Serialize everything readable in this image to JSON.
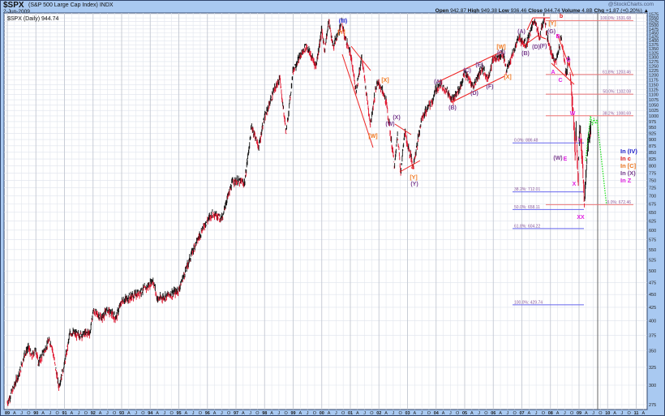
{
  "header": {
    "symbol": "$SPX",
    "name": "(S&P 500 Large Cap Index) INDX",
    "date": "2-Jun-2009",
    "brand": "@StockCharts.com",
    "open_label": "Open",
    "open": "942.87",
    "high_label": "High",
    "high": "949.38",
    "low_label": "Low",
    "low": "936.46",
    "close_label": "Close",
    "close": "944.74",
    "volume_label": "Volume",
    "volume": "4.8B",
    "chg_label": "Chg",
    "chg": "+1.87 (+0.20%)",
    "chg_arrow": "▲"
  },
  "legend": {
    "label": "$SPX (Daily) 944.74"
  },
  "colors": {
    "price": "#111111",
    "price_down": "#e0102a",
    "trend": "#ee2222",
    "fib_red": "#ee7777",
    "fib_blue": "#6666ee",
    "fib_text": "#8a5a9a",
    "projection": "#22dd22",
    "wave_purple": "#7a3f8f",
    "wave_orange": "#f07820",
    "wave_blue": "#2222cc",
    "wave_magenta": "#e020e0",
    "wave_red": "#e02020"
  },
  "chart_data": {
    "type": "line",
    "title": "$SPX (Daily) 944.74",
    "y_scale": "log",
    "ylim": [
      265,
      1590
    ],
    "xlim": [
      1989.0,
      2011.4
    ],
    "grid": true,
    "y_ticks": [
      275,
      300,
      325,
      350,
      375,
      400,
      425,
      450,
      475,
      500,
      525,
      550,
      575,
      600,
      625,
      650,
      675,
      700,
      725,
      750,
      775,
      800,
      825,
      850,
      875,
      900,
      925,
      950,
      975,
      1000,
      1025,
      1050,
      1075,
      1100,
      1125,
      1150,
      1175,
      1200,
      1225,
      1250,
      1275,
      1300,
      1325,
      1350,
      1375,
      1400,
      1425,
      1450,
      1475,
      1500,
      1525,
      1550,
      1575
    ],
    "x_tick_labels": [
      "89",
      "A",
      "J",
      "O",
      "90",
      "A",
      "J",
      "O",
      "91",
      "A",
      "J",
      "O",
      "92",
      "A",
      "J",
      "O",
      "93",
      "A",
      "J",
      "O",
      "94",
      "A",
      "J",
      "O",
      "95",
      "A",
      "J",
      "O",
      "96",
      "A",
      "J",
      "O",
      "97",
      "A",
      "J",
      "O",
      "98",
      "A",
      "J",
      "O",
      "99",
      "A",
      "J",
      "O",
      "00",
      "A",
      "J",
      "O",
      "01",
      "A",
      "J",
      "O",
      "02",
      "A",
      "J",
      "O",
      "03",
      "A",
      "J",
      "O",
      "04",
      "A",
      "J",
      "O",
      "05",
      "A",
      "J",
      "O",
      "06",
      "A",
      "J",
      "O",
      "07",
      "A",
      "J",
      "O",
      "08",
      "A",
      "J",
      "O",
      "09",
      "A",
      "J",
      "O",
      "10",
      "A",
      "J",
      "O",
      "11",
      "A"
    ],
    "series": [
      {
        "points": [
          [
            1989.0,
            277
          ],
          [
            1989.2,
            295
          ],
          [
            1989.45,
            320
          ],
          [
            1989.6,
            345
          ],
          [
            1989.75,
            355
          ],
          [
            1989.85,
            340
          ],
          [
            1990.0,
            353
          ],
          [
            1990.08,
            330
          ],
          [
            1990.45,
            365
          ],
          [
            1990.55,
            360
          ],
          [
            1990.8,
            298
          ],
          [
            1991.0,
            330
          ],
          [
            1991.2,
            380
          ],
          [
            1991.5,
            375
          ],
          [
            1991.9,
            380
          ],
          [
            1992.0,
            418
          ],
          [
            1992.3,
            405
          ],
          [
            1992.5,
            420
          ],
          [
            1992.8,
            405
          ],
          [
            1993.0,
            436
          ],
          [
            1993.5,
            450
          ],
          [
            1993.9,
            465
          ],
          [
            1994.1,
            480
          ],
          [
            1994.25,
            440
          ],
          [
            1994.9,
            455
          ],
          [
            1995.0,
            460
          ],
          [
            1995.5,
            550
          ],
          [
            1995.9,
            615
          ],
          [
            1996.2,
            650
          ],
          [
            1996.55,
            630
          ],
          [
            1996.6,
            665
          ],
          [
            1996.9,
            750
          ],
          [
            1997.3,
            740
          ],
          [
            1997.55,
            955
          ],
          [
            1997.8,
            870
          ],
          [
            1997.95,
            970
          ],
          [
            1998.3,
            1110
          ],
          [
            1998.53,
            1185
          ],
          [
            1998.76,
            925
          ],
          [
            1999.0,
            1230
          ],
          [
            1999.45,
            1370
          ],
          [
            1999.8,
            1250
          ],
          [
            2000.0,
            1470
          ],
          [
            2000.1,
            1345
          ],
          [
            2000.25,
            1525
          ],
          [
            2000.4,
            1360
          ],
          [
            2000.7,
            1520
          ],
          [
            2000.78,
            1440
          ],
          [
            2001.0,
            1320
          ],
          [
            2001.2,
            1120
          ],
          [
            2001.4,
            1300
          ],
          [
            2001.7,
            965
          ],
          [
            2001.9,
            1140
          ],
          [
            2002.0,
            1160
          ],
          [
            2002.25,
            1070
          ],
          [
            2002.55,
            800
          ],
          [
            2002.65,
            920
          ],
          [
            2002.77,
            776
          ],
          [
            2002.9,
            940
          ],
          [
            2003.0,
            880
          ],
          [
            2003.2,
            800
          ],
          [
            2003.5,
            990
          ],
          [
            2003.9,
            1080
          ],
          [
            2004.0,
            1130
          ],
          [
            2004.2,
            1150
          ],
          [
            2004.6,
            1075
          ],
          [
            2004.85,
            1140
          ],
          [
            2005.0,
            1210
          ],
          [
            2005.3,
            1140
          ],
          [
            2005.6,
            1240
          ],
          [
            2005.8,
            1180
          ],
          [
            2006.0,
            1290
          ],
          [
            2006.35,
            1320
          ],
          [
            2006.45,
            1225
          ],
          [
            2006.9,
            1420
          ],
          [
            2007.15,
            1375
          ],
          [
            2007.45,
            1540
          ],
          [
            2007.62,
            1410
          ],
          [
            2007.78,
            1565
          ],
          [
            2007.9,
            1410
          ],
          [
            2008.05,
            1310
          ],
          [
            2008.2,
            1275
          ],
          [
            2008.38,
            1425
          ],
          [
            2008.55,
            1200
          ],
          [
            2008.65,
            1300
          ],
          [
            2008.75,
            1100
          ],
          [
            2008.81,
            1000
          ],
          [
            2008.87,
            840
          ],
          [
            2008.9,
            950
          ],
          [
            2008.97,
            750
          ],
          [
            2009.0,
            900
          ],
          [
            2009.05,
            940
          ],
          [
            2009.15,
            750
          ],
          [
            2009.19,
            676
          ],
          [
            2009.3,
            870
          ],
          [
            2009.42,
            945
          ]
        ]
      }
    ],
    "projection": [
      [
        2009.23,
        818
      ],
      [
        2009.4,
        1000
      ],
      [
        2009.47,
        960
      ],
      [
        2009.52,
        990
      ],
      [
        2009.58,
        965
      ],
      [
        2009.63,
        985
      ],
      [
        2009.96,
        672
      ]
    ],
    "fib_levels": [
      {
        "label": "100.0%: 1531.68",
        "value": 1531.68,
        "set": "red"
      },
      {
        "label": "61.8%: 1203.46",
        "value": 1203.46,
        "set": "red"
      },
      {
        "label": "50.0%: 1102.08",
        "value": 1102.08,
        "set": "red"
      },
      {
        "label": "38.2%: 1000.69",
        "value": 1000.69,
        "set": "red"
      },
      {
        "label": "0.0%: 672.46",
        "value": 672.46,
        "set": "red"
      },
      {
        "label": "0.0%: 886.48",
        "value": 886.48,
        "set": "blue"
      },
      {
        "label": "38.2%: 712.01",
        "value": 712.01,
        "set": "blue"
      },
      {
        "label": "50.0%: 658.11",
        "value": 658.11,
        "set": "blue"
      },
      {
        "label": "61.8%: 604.22",
        "value": 604.22,
        "set": "blue"
      },
      {
        "label": "100.0%: 429.74",
        "value": 429.74,
        "set": "blue"
      }
    ],
    "annotations": [
      {
        "text": "(III)",
        "color": "wave_blue"
      },
      {
        "text": "[Y]",
        "color": "wave_orange"
      },
      {
        "text": "[X]",
        "color": "wave_orange"
      },
      {
        "text": "[W]",
        "color": "wave_orange"
      },
      {
        "text": "(W)",
        "color": "wave_purple"
      },
      {
        "text": "(X)",
        "color": "wave_purple"
      },
      {
        "text": "a",
        "color": "wave_red"
      },
      {
        "text": "[Y]",
        "color": "wave_orange"
      },
      {
        "text": "(Y)",
        "color": "wave_purple"
      },
      {
        "text": "(A)",
        "color": "wave_purple"
      },
      {
        "text": "(B)",
        "color": "wave_purple"
      },
      {
        "text": "(C)",
        "color": "wave_purple"
      },
      {
        "text": "(D)",
        "color": "wave_purple"
      },
      {
        "text": "(E)",
        "color": "wave_purple"
      },
      {
        "text": "(F)",
        "color": "wave_purple"
      },
      {
        "text": "[W]",
        "color": "wave_orange"
      },
      {
        "text": "(G)",
        "color": "wave_purple"
      },
      {
        "text": "[X]",
        "color": "wave_orange"
      },
      {
        "text": "(A)",
        "color": "wave_purple"
      },
      {
        "text": "(B)",
        "color": "wave_purple"
      },
      {
        "text": "(D)",
        "color": "wave_purple"
      },
      {
        "text": "(F)",
        "color": "wave_purple"
      },
      {
        "text": "(G)",
        "color": "wave_purple"
      },
      {
        "text": "[Y]",
        "color": "wave_orange"
      },
      {
        "text": "b",
        "color": "wave_red"
      },
      {
        "text": "A",
        "color": "wave_magenta"
      },
      {
        "text": "B",
        "color": "wave_magenta"
      },
      {
        "text": "C",
        "color": "wave_magenta"
      },
      {
        "text": "D",
        "color": "wave_magenta"
      },
      {
        "text": "W",
        "color": "wave_magenta"
      },
      {
        "text": "Y",
        "color": "wave_magenta"
      },
      {
        "text": "(W)",
        "color": "wave_purple"
      },
      {
        "text": "E",
        "color": "wave_magenta"
      },
      {
        "text": "X",
        "color": "wave_magenta"
      },
      {
        "text": "XX",
        "color": "wave_magenta"
      }
    ],
    "wave_legend": [
      {
        "text": "In (IV)",
        "color": "wave_blue"
      },
      {
        "text": "In c",
        "color": "wave_red"
      },
      {
        "text": "In [C]",
        "color": "wave_orange"
      },
      {
        "text": "In (X)",
        "color": "wave_purple"
      },
      {
        "text": "In Z",
        "color": "wave_magenta"
      }
    ]
  }
}
